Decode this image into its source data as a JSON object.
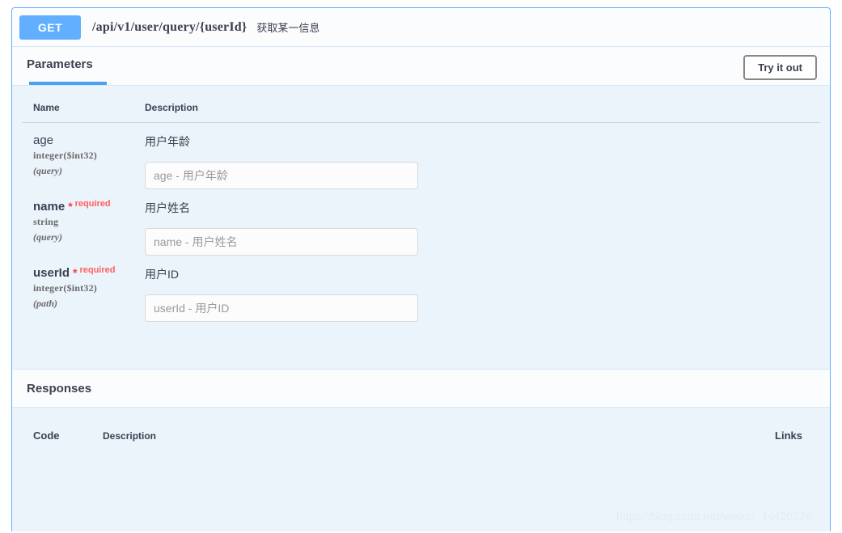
{
  "operation": {
    "method": "GET",
    "path": "/api/v1/user/query/{userId}",
    "summary": "获取某一信息"
  },
  "parameters_section": {
    "tab_label": "Parameters",
    "try_it_out_label": "Try it out",
    "columns": {
      "name": "Name",
      "description": "Description"
    },
    "rows": [
      {
        "name": "age",
        "required": false,
        "required_label": "",
        "type": "integer($int32)",
        "in": "(query)",
        "description": "用户年龄",
        "placeholder": "age - 用户年龄",
        "value": ""
      },
      {
        "name": "name",
        "required": true,
        "required_label": "required",
        "type": "string",
        "in": "(query)",
        "description": "用户姓名",
        "placeholder": "name - 用户姓名",
        "value": ""
      },
      {
        "name": "userId",
        "required": true,
        "required_label": "required",
        "type": "integer($int32)",
        "in": "(path)",
        "description": "用户ID",
        "placeholder": "userId - 用户ID",
        "value": ""
      }
    ]
  },
  "responses_section": {
    "title": "Responses",
    "columns": {
      "code": "Code",
      "description": "Description",
      "links": "Links"
    }
  },
  "watermark": {
    "text": "https://blog.csdn.net/weixin_44420276"
  },
  "colors": {
    "method_get": "#61affe",
    "block_border": "#61affe",
    "block_background": "#ebf3fb",
    "header_background": "#fbfcfd",
    "tab_underline": "#4d9ef5",
    "required_star": "#f93e3e",
    "required_label": "#ff6060",
    "text_primary": "#3b4151"
  },
  "icons": {
    "required_asterisk": "*"
  }
}
